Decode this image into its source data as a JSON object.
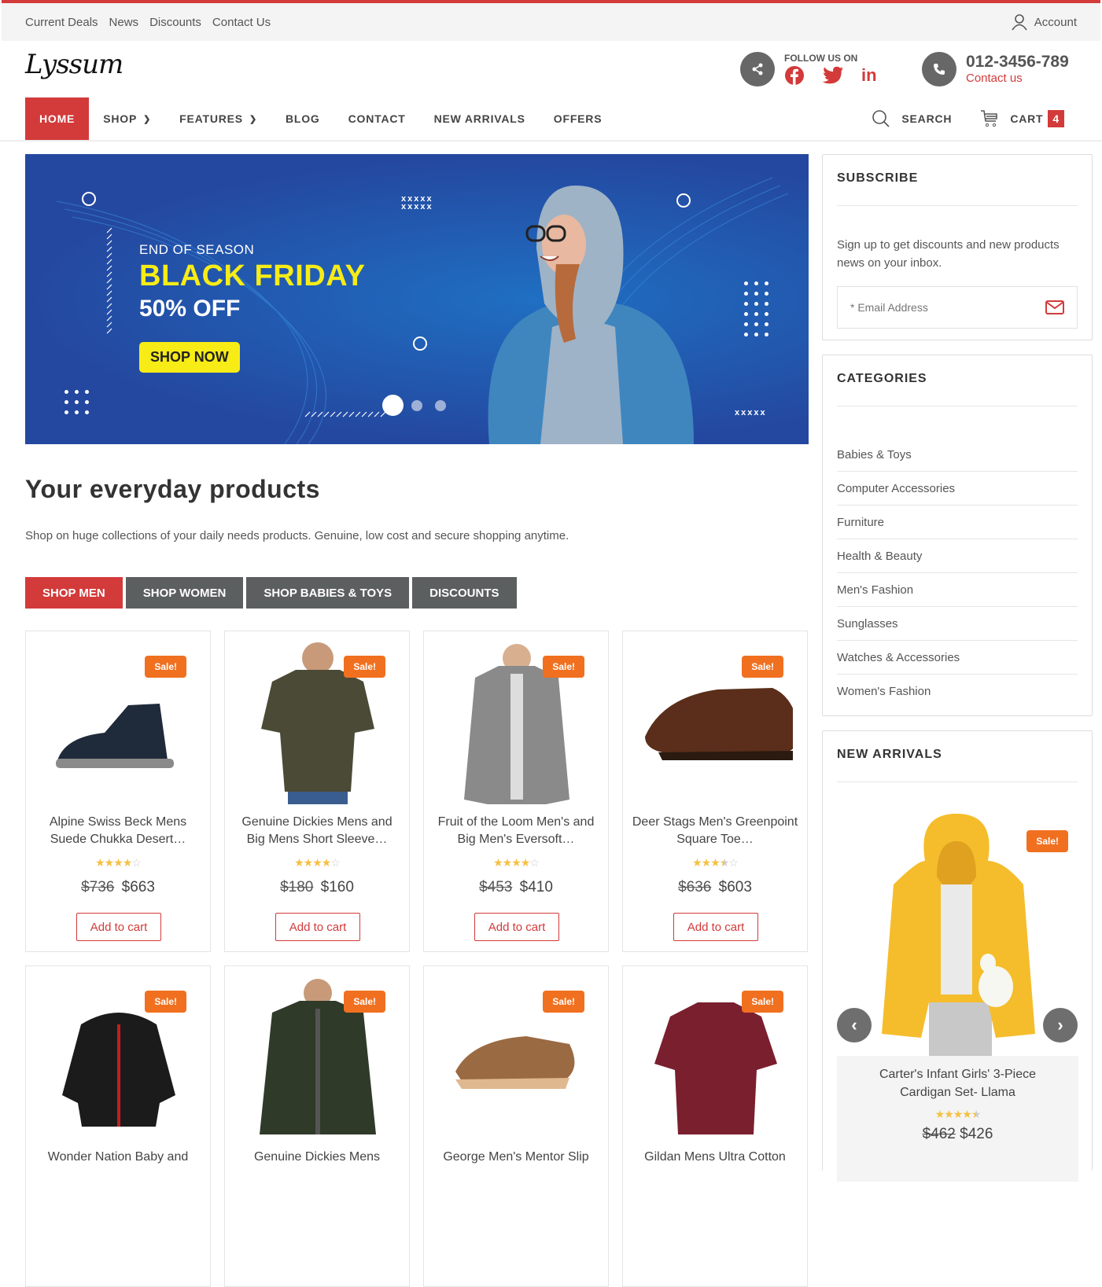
{
  "topbar": {
    "links": [
      "Current Deals",
      "News",
      "Discounts",
      "Contact Us"
    ],
    "account_label": "Account"
  },
  "header": {
    "logo": "Lyssum",
    "follow_label": "FOLLOW US ON",
    "socials": [
      "facebook",
      "twitter",
      "linkedin"
    ],
    "phone": "012-3456-789",
    "contact_link": "Contact us"
  },
  "nav": {
    "items": [
      {
        "label": "HOME",
        "active": true
      },
      {
        "label": "SHOP",
        "dropdown": true
      },
      {
        "label": "FEATURES",
        "dropdown": true
      },
      {
        "label": "BLOG"
      },
      {
        "label": "CONTACT"
      },
      {
        "label": "NEW ARRIVALS"
      },
      {
        "label": "OFFERS"
      }
    ],
    "search_label": "SEARCH",
    "cart_label": "CART",
    "cart_count": "4"
  },
  "banner": {
    "eyebrow": "END OF SEASON",
    "title": "BLACK FRIDAY",
    "discount": "50% OFF",
    "cta": "SHOP NOW",
    "slides": 3,
    "active_slide": 1
  },
  "main": {
    "title": "Your everyday products",
    "subtitle": "Shop on huge collections of your daily needs products. Genuine, low cost and secure shopping anytime.",
    "tabs": [
      "SHOP MEN",
      "SHOP WOMEN",
      "SHOP BABIES & TOYS",
      "DISCOUNTS"
    ],
    "active_tab": 0,
    "sale_label": "Sale!",
    "add_to_cart_label": "Add to cart",
    "products": [
      {
        "name": "Alpine Swiss Beck Mens Suede Chukka Desert…",
        "rating": 4,
        "old_price": "$736",
        "price": "$663",
        "image": "navy-chukka-boot"
      },
      {
        "name": "Genuine Dickies Mens and Big Mens Short Sleeve…",
        "rating": 4,
        "old_price": "$180",
        "price": "$160",
        "image": "olive-tshirt"
      },
      {
        "name": "Fruit of the Loom Men's and Big Men's Eversoft…",
        "rating": 4,
        "old_price": "$453",
        "price": "$410",
        "image": "grey-hoodie"
      },
      {
        "name": "Deer Stags Men's Greenpoint Square Toe…",
        "rating": 3.5,
        "old_price": "$636",
        "price": "$603",
        "image": "brown-loafer"
      },
      {
        "name": "Wonder Nation Baby and",
        "image": "black-puffer-jacket"
      },
      {
        "name": "Genuine Dickies Mens",
        "image": "green-work-jacket"
      },
      {
        "name": "George Men's Mentor Slip",
        "image": "tan-slip-on-shoe"
      },
      {
        "name": "Gildan Mens Ultra Cotton",
        "image": "maroon-tshirt"
      }
    ]
  },
  "sidebar": {
    "subscribe": {
      "title": "SUBSCRIBE",
      "text": "Sign up to get discounts and new products news on your inbox.",
      "email_placeholder": "* Email Address"
    },
    "categories": {
      "title": "CATEGORIES",
      "items": [
        "Babies & Toys",
        "Computer Accessories",
        "Furniture",
        "Health & Beauty",
        "Men's Fashion",
        "Sunglasses",
        "Watches & Accessories",
        "Women's Fashion"
      ]
    },
    "new_arrivals": {
      "title": "NEW ARRIVALS",
      "sale_label": "Sale!",
      "product": {
        "name": "Carter's Infant Girls' 3-Piece Cardigan Set- Llama",
        "rating": 4.5,
        "old_price": "$462",
        "price": "$426",
        "image": "yellow-llama-cardigan"
      }
    }
  },
  "colors": {
    "accent": "#d33a3a",
    "sale": "#f07020",
    "banner_yellow": "#f7ec16",
    "tab_dark": "#5c5f5f"
  }
}
